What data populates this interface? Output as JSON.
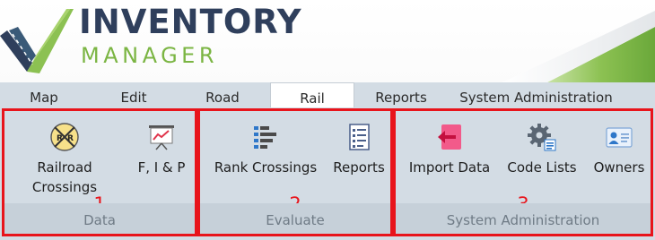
{
  "brand": {
    "line1": "INVENTORY",
    "line2": "MANAGER"
  },
  "tabs": [
    {
      "label": "Map"
    },
    {
      "label": "Edit"
    },
    {
      "label": "Road"
    },
    {
      "label": "Rail",
      "active": true
    },
    {
      "label": "Reports"
    },
    {
      "label": "System Administration"
    }
  ],
  "groups": [
    {
      "number": "1",
      "footer": "Data",
      "buttons": [
        {
          "label": "Railroad\nCrossings",
          "icon": "railroad-crossing-icon"
        },
        {
          "label": "F, I & P",
          "icon": "presentation-chart-icon"
        }
      ]
    },
    {
      "number": "2",
      "footer": "Evaluate",
      "buttons": [
        {
          "label": "Rank Crossings",
          "icon": "ranking-list-icon"
        },
        {
          "label": "Reports",
          "icon": "report-document-icon"
        }
      ]
    },
    {
      "number": "3",
      "footer": "System Administration",
      "buttons": [
        {
          "label": "Import Data",
          "icon": "import-arrow-icon"
        },
        {
          "label": "Code Lists",
          "icon": "gear-list-icon"
        },
        {
          "label": "Owners",
          "icon": "contact-card-icon"
        }
      ]
    }
  ],
  "colors": {
    "brand_navy": "#2f3f5c",
    "brand_green": "#7bb543",
    "ribbon": "#d3dce4",
    "highlight_red": "#e8141b"
  }
}
